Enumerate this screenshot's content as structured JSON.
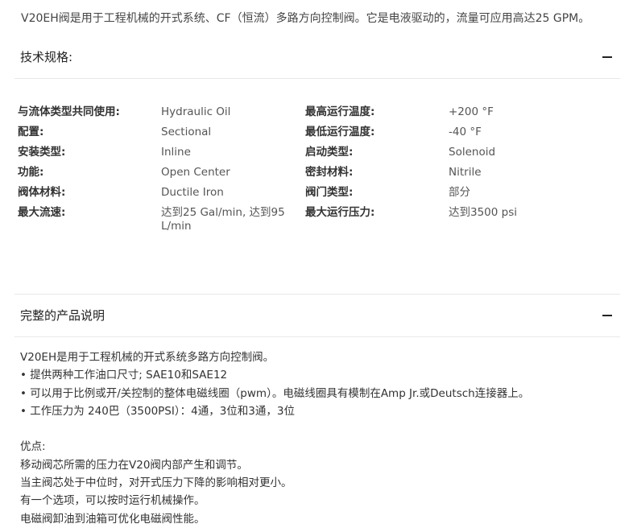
{
  "intro_text": "V20EH阀是用于工程机械的开式系统、CF（恒流）多路方向控制阀。它是电液驱动的，流量可应用高达25 GPM。",
  "spec_section": {
    "title": "技术规格:",
    "collapse_icon": "minus-icon",
    "rows": [
      {
        "label1": "与流体类型共同使用:",
        "value1": "Hydraulic Oil",
        "label2": "最高运行温度:",
        "value2": "+200 °F"
      },
      {
        "label1": "配置:",
        "value1": "Sectional",
        "label2": "最低运行温度:",
        "value2": "-40 °F"
      },
      {
        "label1": "安装类型:",
        "value1": "Inline",
        "label2": "启动类型:",
        "value2": "Solenoid"
      },
      {
        "label1": "功能:",
        "value1": "Open Center",
        "label2": "密封材料:",
        "value2": "Nitrile"
      },
      {
        "label1": "阀体材料:",
        "value1": "Ductile Iron",
        "label2": "阀门类型:",
        "value2": "部分"
      },
      {
        "label1": "最大流速:",
        "value1": "达到25 Gal/min, 达到95 L/min",
        "label2": "最大运行压力:",
        "value2": "达到3500 psi"
      }
    ]
  },
  "desc_section": {
    "title": "完整的产品说明",
    "collapse_icon": "minus-icon",
    "lines": [
      "V20EH是用于工程机械的开式系统多路方向控制阀。",
      "• 提供两种工作油口尺寸; SAE10和SAE12",
      "• 可以用于比例或开/关控制的整体电磁线圈（pwm）。电磁线圈具有模制在Amp Jr.或Deutsch连接器上。",
      "• 工作压力为 240巴（3500PSI）：4通，3位和3通，3位",
      "",
      "优点:",
      "移动阀芯所需的压力在V20阀内部产生和调节。",
      "当主阀芯处于中位时，对开式压力下降的影响相对更小。",
      "有一个选项，可以按时运行机械操作。",
      "电磁阀卸油到油箱可优化电磁阀性能。"
    ]
  }
}
